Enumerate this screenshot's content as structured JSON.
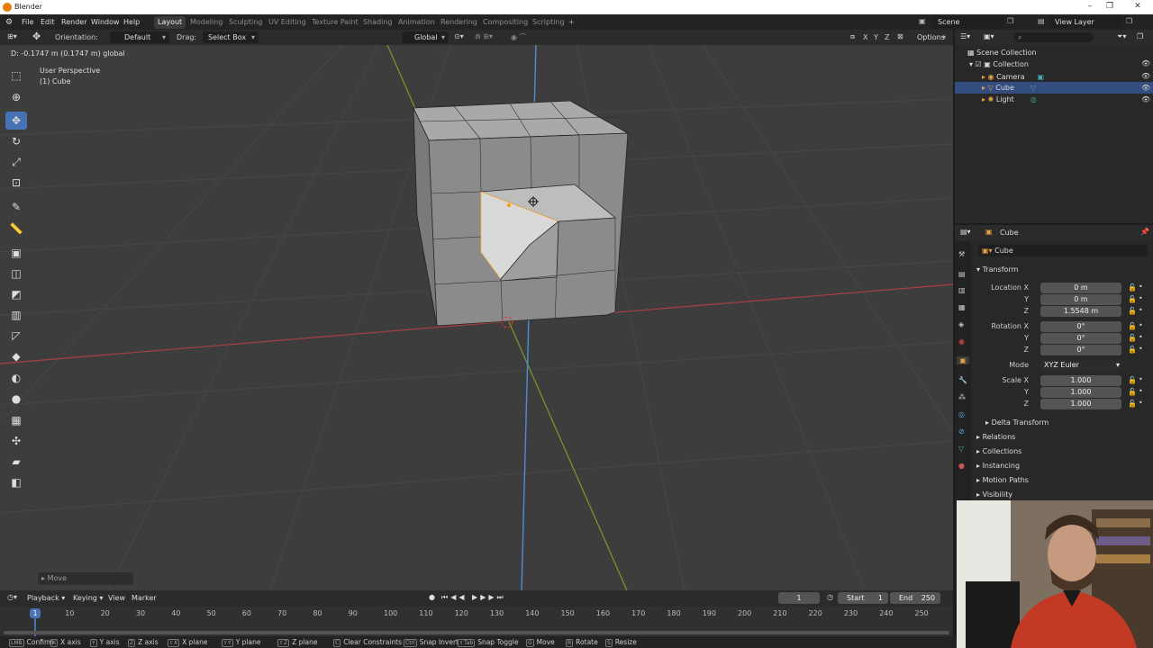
{
  "window": {
    "title": "Blender",
    "min": "–",
    "restore": "❐",
    "close": "✕"
  },
  "menu": [
    "File",
    "Edit",
    "Render",
    "Window",
    "Help"
  ],
  "workspaces": [
    "Layout",
    "Modeling",
    "Sculpting",
    "UV Editing",
    "Texture Paint",
    "Shading",
    "Animation",
    "Rendering",
    "Compositing",
    "Scripting"
  ],
  "workspace_add": "+",
  "scene": {
    "label": "Scene",
    "view_layer": "View Layer"
  },
  "header": {
    "orientation_label": "Orientation:",
    "orientation_value": "Default",
    "drag_label": "Drag:",
    "drag_value": "Select Box",
    "transform_orientation": "Global",
    "axes": [
      "X",
      "Y",
      "Z"
    ],
    "options": "Options"
  },
  "viewport": {
    "status_readout": "D: -0.1747 m (0.1747 m) global",
    "perspective": "User Perspective",
    "object": "(1) Cube",
    "last_op": "Move"
  },
  "outliner": {
    "root": "Scene Collection",
    "collection": "Collection",
    "items": [
      {
        "name": "Camera",
        "icon": "camera-icon",
        "selected": false
      },
      {
        "name": "Cube",
        "icon": "mesh-icon",
        "selected": true
      },
      {
        "name": "Light",
        "icon": "light-icon",
        "selected": false
      }
    ]
  },
  "properties": {
    "object_name": "Cube",
    "data_name": "Cube",
    "transform_title": "Transform",
    "location": {
      "label_x": "Location X",
      "label_y": "Y",
      "label_z": "Z",
      "x": "0 m",
      "y": "0 m",
      "z": "1.5548 m"
    },
    "rotation": {
      "label_x": "Rotation X",
      "label_y": "Y",
      "label_z": "Z",
      "x": "0°",
      "y": "0°",
      "z": "0°"
    },
    "mode": {
      "label": "Mode",
      "value": "XYZ Euler"
    },
    "scale": {
      "label_x": "Scale X",
      "label_y": "Y",
      "label_z": "Z",
      "x": "1.000",
      "y": "1.000",
      "z": "1.000"
    },
    "delta": "Delta Transform",
    "panels": [
      "Relations",
      "Collections",
      "Instancing",
      "Motion Paths",
      "Visibility"
    ]
  },
  "timeline": {
    "menus": [
      "Playback",
      "Keying",
      "View",
      "Marker"
    ],
    "current_frame": "1",
    "start_label": "Start",
    "start": "1",
    "end_label": "End",
    "end": "250",
    "ticks": [
      "0",
      "10",
      "20",
      "30",
      "40",
      "50",
      "60",
      "70",
      "80",
      "90",
      "100",
      "110",
      "120",
      "130",
      "140",
      "150",
      "160",
      "170",
      "180",
      "190",
      "200",
      "210",
      "220",
      "230",
      "240",
      "250"
    ],
    "playhead_label": "1"
  },
  "statusbar": [
    {
      "key": "LMB",
      "label": "Confirm"
    },
    {
      "key": "X",
      "label": "X axis"
    },
    {
      "key": "Y",
      "label": "Y axis"
    },
    {
      "key": "Z",
      "label": "Z axis"
    },
    {
      "key": "⇧X",
      "label": "X plane"
    },
    {
      "key": "⇧Y",
      "label": "Y plane"
    },
    {
      "key": "⇧Z",
      "label": "Z plane"
    },
    {
      "key": "C",
      "label": "Clear Constraints"
    },
    {
      "key": "Ctrl",
      "label": "Snap Invert"
    },
    {
      "key": "⇧Tab",
      "label": "Snap Toggle"
    },
    {
      "key": "G",
      "label": "Move"
    },
    {
      "key": "R",
      "label": "Rotate"
    },
    {
      "key": "S",
      "label": "Resize"
    }
  ],
  "colors": {
    "accent": "#4772b3",
    "x_axis": "#c04848",
    "y_axis": "#8fb032",
    "z_axis": "#5a9ad8",
    "selected_face": "#d9d9d9"
  }
}
